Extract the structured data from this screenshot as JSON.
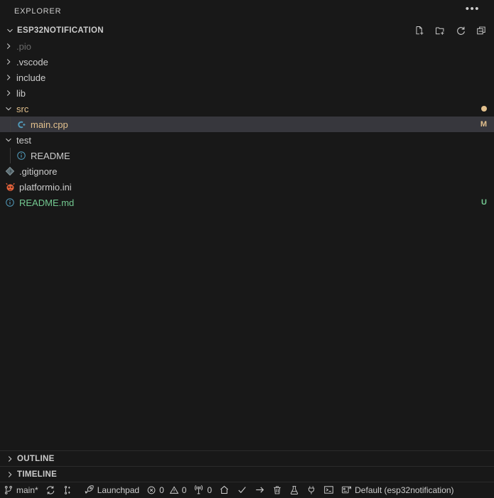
{
  "explorer": {
    "title": "EXPLORER",
    "more_actions_label": "•••",
    "more_actions_name": "ellipsis-icon"
  },
  "root": {
    "name": "ESP32NOTIFICATION",
    "expanded": true,
    "actions": [
      {
        "name": "new-file-icon",
        "tooltip": "New File..."
      },
      {
        "name": "new-folder-icon",
        "tooltip": "New Folder..."
      },
      {
        "name": "refresh-icon",
        "tooltip": "Refresh Explorer"
      },
      {
        "name": "collapse-all-icon",
        "tooltip": "Collapse Folders in Explorer"
      }
    ]
  },
  "tree": [
    {
      "label": ".pio",
      "type": "folder",
      "expanded": false,
      "depth": 1,
      "state": "ignored",
      "badge": ""
    },
    {
      "label": ".vscode",
      "type": "folder",
      "expanded": false,
      "depth": 1,
      "state": "normal",
      "badge": ""
    },
    {
      "label": "include",
      "type": "folder",
      "expanded": false,
      "depth": 1,
      "state": "normal",
      "badge": ""
    },
    {
      "label": "lib",
      "type": "folder",
      "expanded": false,
      "depth": 1,
      "state": "normal",
      "badge": ""
    },
    {
      "label": "src",
      "type": "folder",
      "expanded": true,
      "depth": 1,
      "state": "modified",
      "badge": "dot"
    },
    {
      "label": "main.cpp",
      "type": "file",
      "icon": "cpp-file-icon",
      "depth": 2,
      "state": "modified",
      "badge": "M",
      "selected": true
    },
    {
      "label": "test",
      "type": "folder",
      "expanded": true,
      "depth": 1,
      "state": "normal",
      "badge": ""
    },
    {
      "label": "README",
      "type": "file",
      "icon": "info-file-icon",
      "depth": 2,
      "state": "normal",
      "badge": ""
    },
    {
      "label": ".gitignore",
      "type": "file",
      "icon": "git-file-icon",
      "depth": 1,
      "state": "normal",
      "badge": ""
    },
    {
      "label": "platformio.ini",
      "type": "file",
      "icon": "platformio-file-icon",
      "depth": 1,
      "state": "normal",
      "badge": ""
    },
    {
      "label": "README.md",
      "type": "file",
      "icon": "info-file-icon",
      "depth": 1,
      "state": "untracked",
      "badge": "U"
    }
  ],
  "panels": [
    {
      "label": "OUTLINE",
      "expanded": false
    },
    {
      "label": "TIMELINE",
      "expanded": false
    }
  ],
  "status_bar": {
    "branch": "main*",
    "branch_icon": "source-control-branch-icon",
    "sync_icon": "sync-icon",
    "source_control_graph_icon": "source-control-graph-icon",
    "launchpad": "Launchpad",
    "launchpad_icon": "rocket-icon",
    "errors": "0",
    "errors_icon": "error-circle-icon",
    "warnings": "0",
    "warnings_icon": "warning-triangle-icon",
    "ports": "0",
    "ports_icon": "radio-tower-icon",
    "home_icon": "home-icon",
    "build_icon": "check-icon",
    "upload_icon": "arrow-right-icon",
    "clean_icon": "trash-icon",
    "test_icon": "beaker-icon",
    "serial_monitor_icon": "plug-icon",
    "terminal_icon": "terminal-icon",
    "environment_icon": "plug-board-icon",
    "environment": "Default (esp32notification)"
  },
  "colors": {
    "background": "#181818",
    "selected_row": "#37373d",
    "foreground": "#cccccc",
    "modified": "#e2c08d",
    "untracked": "#73c991",
    "ignored": "#6a6a6a",
    "indent_guide": "#3b3b3b",
    "cpp_blue": "#519aba",
    "info_blue": "#519aba",
    "platformio_orange": "#e8643c",
    "git_gray": "#6d8086"
  }
}
